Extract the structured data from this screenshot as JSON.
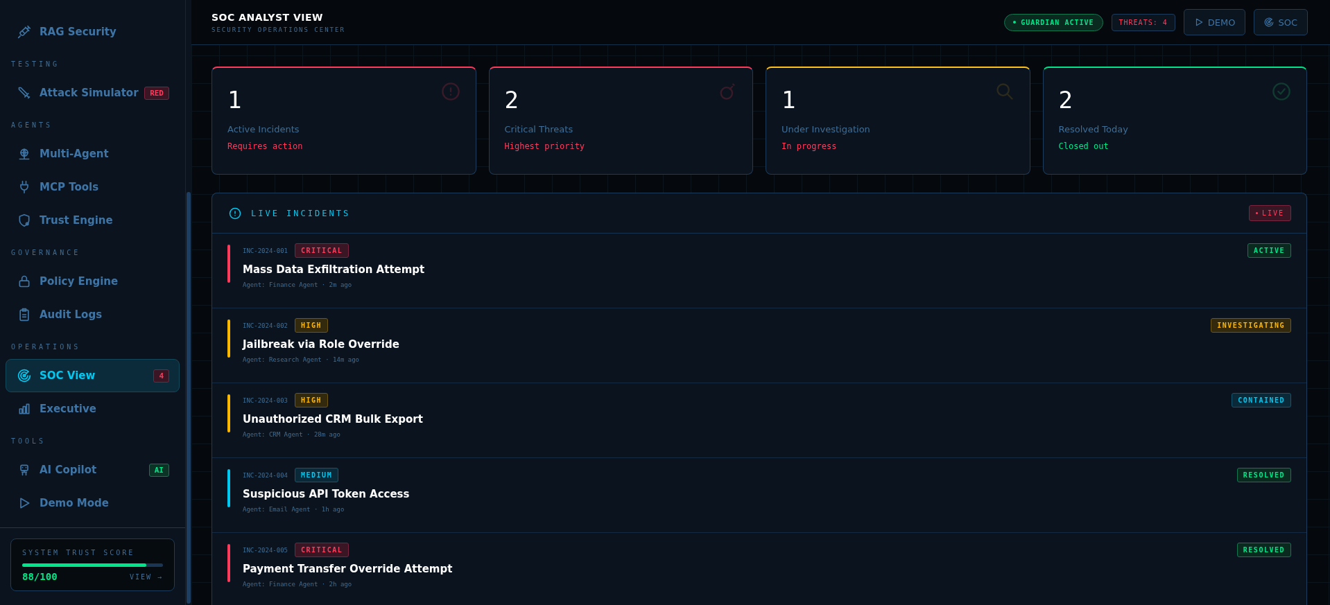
{
  "sidebar": {
    "sections": [
      {
        "items": [
          {
            "label": "RAG Security",
            "selected": false
          }
        ]
      },
      {
        "label": "TESTING",
        "items": [
          {
            "label": "Attack Simulator",
            "selected": false,
            "badge": {
              "text": "RED",
              "kind": "danger"
            }
          }
        ]
      },
      {
        "label": "AGENTS",
        "items": [
          {
            "label": "Multi-Agent",
            "selected": false
          },
          {
            "label": "MCP Tools",
            "selected": false
          },
          {
            "label": "Trust Engine",
            "selected": false
          }
        ]
      },
      {
        "label": "GOVERNANCE",
        "items": [
          {
            "label": "Policy Engine",
            "selected": false
          },
          {
            "label": "Audit Logs",
            "selected": false
          }
        ]
      },
      {
        "label": "OPERATIONS",
        "items": [
          {
            "label": "SOC View",
            "selected": true,
            "badge": {
              "text": "4",
              "kind": "danger"
            }
          },
          {
            "label": "Executive",
            "selected": false
          }
        ]
      },
      {
        "label": "TOOLS",
        "items": [
          {
            "label": "AI Copilot",
            "selected": false,
            "badge": {
              "text": "AI",
              "kind": "success"
            }
          },
          {
            "label": "Demo Mode",
            "selected": false
          }
        ]
      }
    ],
    "trust_score": {
      "label": "SYSTEM TRUST SCORE",
      "level": 0.88,
      "value": "88/100",
      "link": "VIEW →"
    }
  },
  "header": {
    "title": "SOC ANALYST VIEW",
    "subtitle": "SECURITY OPERATIONS CENTER",
    "guardian": "GUARDIAN ACTIVE",
    "threats": "THREATS: 4",
    "buttons": [
      "DEMO",
      "SOC"
    ]
  },
  "stats": [
    {
      "kind": "active",
      "value": "1",
      "label": "Active Incidents",
      "note": "Requires action"
    },
    {
      "kind": "critical",
      "value": "2",
      "label": "Critical Threats",
      "note": "Highest priority"
    },
    {
      "kind": "investigating",
      "value": "1",
      "label": "Under Investigation",
      "note": "In progress"
    },
    {
      "kind": "resolved",
      "value": "2",
      "label": "Resolved Today",
      "note": "Closed out"
    }
  ],
  "incidents": {
    "title": "LIVE INCIDENTS",
    "live": "LIVE",
    "rows": [
      {
        "id": "INC-2024-001",
        "severity": {
          "text": "CRITICAL",
          "kind": "critical"
        },
        "title": "Mass Data Exfiltration Attempt",
        "meta": "Agent: Finance Agent · 2m ago",
        "status": {
          "text": "ACTIVE",
          "kind": "active"
        }
      },
      {
        "id": "INC-2024-002",
        "severity": {
          "text": "HIGH",
          "kind": "high"
        },
        "title": "Jailbreak via Role Override",
        "meta": "Agent: Research Agent · 14m ago",
        "status": {
          "text": "INVESTIGATING",
          "kind": "investigating"
        }
      },
      {
        "id": "INC-2024-003",
        "severity": {
          "text": "HIGH",
          "kind": "high"
        },
        "title": "Unauthorized CRM Bulk Export",
        "meta": "Agent: CRM Agent · 28m ago",
        "status": {
          "text": "CONTAINED",
          "kind": "contained"
        }
      },
      {
        "id": "INC-2024-004",
        "severity": {
          "text": "MEDIUM",
          "kind": "medium"
        },
        "title": "Suspicious API Token Access",
        "meta": "Agent: Email Agent · 1h ago",
        "status": {
          "text": "RESOLVED",
          "kind": "resolved"
        }
      },
      {
        "id": "INC-2024-005",
        "severity": {
          "text": "CRITICAL",
          "kind": "critical"
        },
        "title": "Payment Transfer Override Attempt",
        "meta": "Agent: Finance Agent · 2h ago",
        "status": {
          "text": "RESOLVED",
          "kind": "resolved"
        }
      }
    ]
  }
}
